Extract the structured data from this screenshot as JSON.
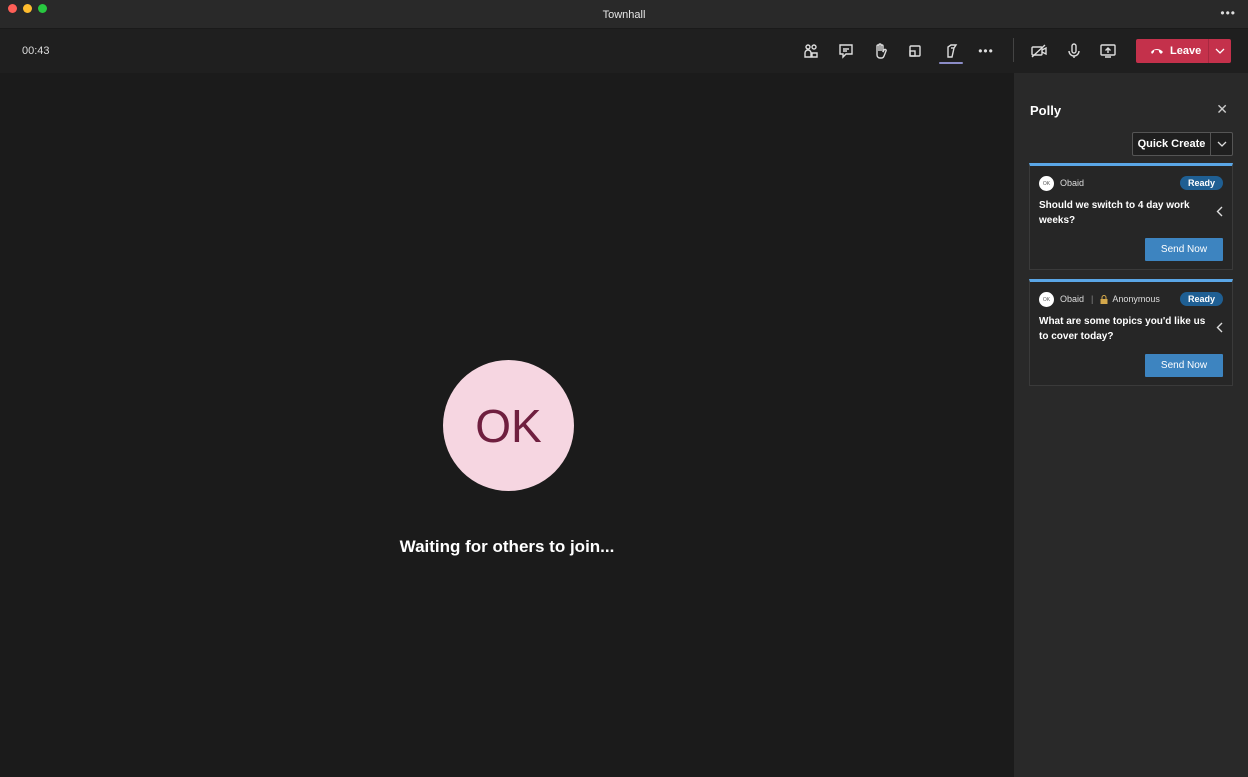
{
  "window": {
    "title": "Townhall",
    "more_label": "•••",
    "traffic_lights": {
      "close": "#fe5f57",
      "minimize": "#febc2e",
      "maximize": "#28c840"
    }
  },
  "toolbar": {
    "timer": "00:43",
    "icons": [
      "people-icon",
      "chat-icon",
      "raise-hand-icon",
      "share-tray-icon",
      "apps-icon",
      "more-icon"
    ],
    "active_item": "apps-icon",
    "more_label": "•••",
    "leave_label": "Leave",
    "leave_color": "#c4314b"
  },
  "stage": {
    "avatar_initials": "OK",
    "avatar_bg": "#f6d6e1",
    "avatar_fg": "#6f1f3f",
    "status_text": "Waiting for others to join..."
  },
  "panel": {
    "title": "Polly",
    "close_label": "✕",
    "quick_create_label": "Quick Create",
    "polls": [
      {
        "author_initials": "OK",
        "author": "Obaid",
        "anonymous": false,
        "anonymous_label": "",
        "status": "Ready",
        "question": "Should we switch to 4 day work weeks?",
        "send_label": "Send Now"
      },
      {
        "author_initials": "OK",
        "author": "Obaid",
        "anonymous": true,
        "separator": "|",
        "anonymous_label": "Anonymous",
        "status": "Ready",
        "question": "What are some topics you'd like us to cover today?",
        "send_label": "Send Now"
      }
    ]
  }
}
